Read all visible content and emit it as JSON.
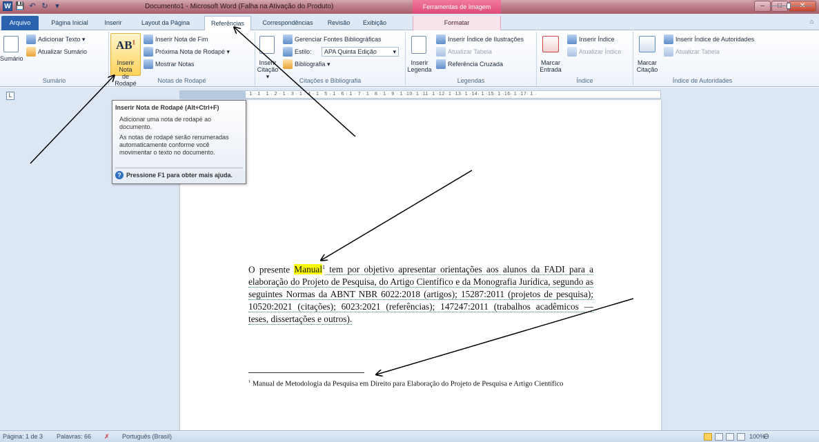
{
  "titlebar": {
    "title": "Documento1 - Microsoft Word (Falha na Ativação do Produto)",
    "context_header": "Ferramentas de Imagem",
    "minimize": "–",
    "maximize": "□",
    "close": "✕"
  },
  "tabs": {
    "file": "Arquivo",
    "home": "Página Inicial",
    "insert": "Inserir",
    "layout": "Layout da Página",
    "references": "Referências",
    "mailings": "Correspondências",
    "review": "Revisão",
    "view": "Exibição",
    "format": "Formatar"
  },
  "ribbon": {
    "sumario": {
      "label": "Sumário",
      "big": "Sumário",
      "add_text": "Adicionar Texto ▾",
      "update": "Atualizar Sumário"
    },
    "notas": {
      "label": "Notas de Rodapé",
      "big_icon": "AB",
      "big_sup": "1",
      "big_line1": "Inserir Nota",
      "big_line2": "de Rodapé",
      "endnote": "Inserir Nota de Fim",
      "next": "Próxima Nota de Rodapé ▾",
      "show": "Mostrar Notas"
    },
    "citacoes": {
      "label": "Citações e Bibliografia",
      "big_line1": "Inserir",
      "big_line2": "Citação ▾",
      "manage": "Gerenciar Fontes Bibliográficas",
      "style_label": "Estilo:",
      "style_value": "APA Quinta Edição",
      "bibliography": "Bibliografia ▾"
    },
    "legendas": {
      "label": "Legendas",
      "big_line1": "Inserir",
      "big_line2": "Legenda",
      "insert_index": "Inserir Índice de Ilustrações",
      "update_table": "Atualizar Tabela",
      "cross_ref": "Referência Cruzada"
    },
    "indice": {
      "label": "Índice",
      "big_line1": "Marcar",
      "big_line2": "Entrada",
      "insert_index": "Inserir Índice",
      "update_index": "Atualizar Índice"
    },
    "autoridades": {
      "label": "Índice de Autoridades",
      "big_line1": "Marcar",
      "big_line2": "Citação",
      "insert_index": "Inserir Índice de Autoridades",
      "update_table": "Atualizar Tabela"
    }
  },
  "tooltip": {
    "title": "Inserir Nota de Rodapé (Alt+Ctrl+F)",
    "p1": "Adicionar uma nota de rodapé ao documento.",
    "p2": "As notas de rodapé serão renumeradas automaticamente conforme você movimentar o texto no documento.",
    "help": "Pressione F1 para obter mais ajuda."
  },
  "ruler": {
    "marks": "· 1 · 1 · 1 · 2 · 1 · 3 · 1 · 4 · 1 · 5 · 1 · 6 · 1 · 7 · 1 · 8 · 1 · 9 · 1 ·10· 1 ·11· 1 ·12· 1 ·13· 1 ·14· 1 ·15· 1 ·16· 1 ·17· 1 ·"
  },
  "document": {
    "before": "O presente ",
    "highlight": "Manual",
    "sup": "1",
    "after": " tem por objetivo apresentar orientações aos alunos da FADI para a elaboração do Projeto de Pesquisa, do Artigo Científico e da Monografia Jurídica, segundo as seguintes Normas da ABNT NBR 6022:2018 (artigos); 15287:2011 (projetos de pesquisa); 10520:2021 (citações); 6023:2021 (referências); 147247:2011 (trabalhos acadêmicos — teses, dissertações e outros).",
    "footnote_sup": "1",
    "footnote": " Manual de Metodologia da Pesquisa em Direito para Elaboração do Projeto de Pesquisa e Artigo Científico"
  },
  "status": {
    "page": "Página: 1 de 3",
    "words": "Palavras: 66",
    "language": "Português (Brasil)",
    "zoom": "100%"
  },
  "colors": {
    "file_tab": "#2a62b0",
    "highlight": "#ffff00",
    "titlebar": "#bd7f89"
  }
}
